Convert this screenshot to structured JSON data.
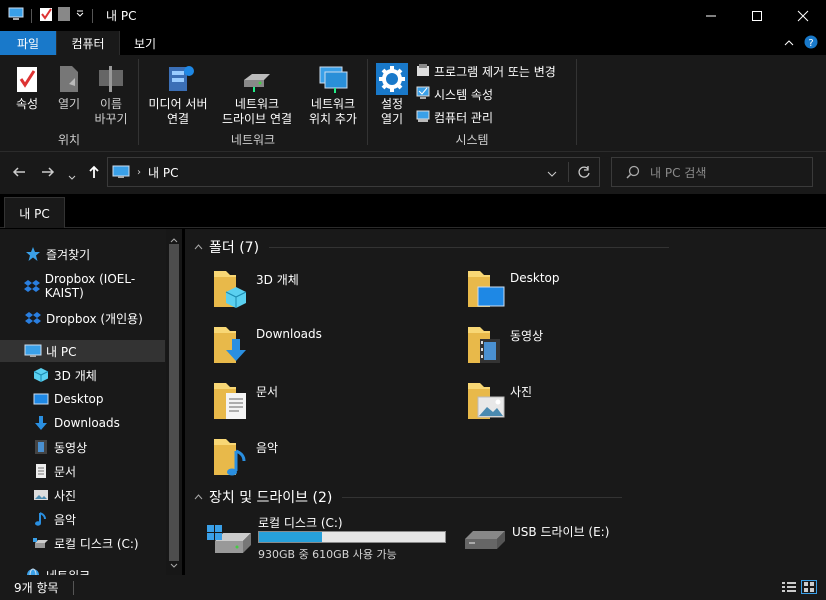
{
  "window": {
    "title": "내 PC"
  },
  "ribbon_tabs": [
    {
      "label": "파일"
    },
    {
      "label": "컴퓨터"
    },
    {
      "label": "보기"
    }
  ],
  "ribbon": {
    "location": {
      "label": "위치",
      "properties": "속성",
      "open": "열기",
      "rename_1": "이름",
      "rename_2": "바꾸기"
    },
    "network": {
      "label": "네트워크",
      "media_1": "미디어 서버",
      "media_2": "연결",
      "map_1": "네트워크",
      "map_2": "드라이브 연결",
      "add_1": "네트워크",
      "add_2": "위치 추가"
    },
    "system": {
      "label": "시스템",
      "settings_1": "설정",
      "settings_2": "열기",
      "uninstall": "프로그램 제거 또는 변경",
      "sysprops": "시스템 속성",
      "manage": "컴퓨터 관리"
    }
  },
  "address": {
    "path": "내 PC"
  },
  "search": {
    "placeholder": "내 PC 검색"
  },
  "location_tab": "내 PC",
  "nav": {
    "quick_access": "즐겨찾기",
    "dropbox_work": "Dropbox (IOEL-KAIST)",
    "dropbox_personal": "Dropbox (개인용)",
    "this_pc": "내 PC",
    "items": [
      "3D 개체",
      "Desktop",
      "Downloads",
      "동영상",
      "문서",
      "사진",
      "음악",
      "로컬 디스크 (C:)"
    ],
    "network": "네트워크"
  },
  "folders": {
    "header": "폴더 (7)",
    "items": [
      "3D 개체",
      "Desktop",
      "Downloads",
      "동영상",
      "문서",
      "사진",
      "음악"
    ]
  },
  "drives": {
    "header": "장치 및 드라이브 (2)",
    "local": {
      "name": "로컬 디스크 (C:)",
      "free": "930GB 중 610GB 사용 가능",
      "used_fraction": 0.34
    },
    "usb": {
      "name": "USB 드라이브 (E:)"
    }
  },
  "status": {
    "count": "9개 항목"
  },
  "colors": {
    "accent": "#1979ca",
    "folder": "#f8d775",
    "bar": "#26a0da"
  }
}
